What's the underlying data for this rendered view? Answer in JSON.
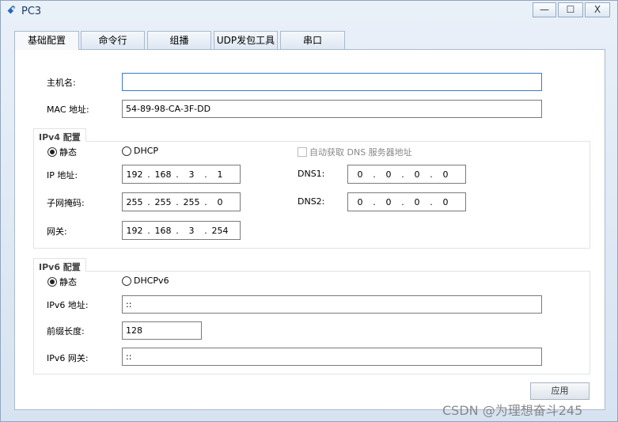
{
  "window": {
    "title": "PC3",
    "minimize": "—",
    "maximize": "☐",
    "close": "X"
  },
  "tabs": [
    {
      "label": "基础配置"
    },
    {
      "label": "命令行"
    },
    {
      "label": "组播"
    },
    {
      "label": "UDP发包工具"
    },
    {
      "label": "串口"
    }
  ],
  "basic": {
    "hostname_label": "主机名:",
    "hostname_value": "",
    "mac_label": "MAC 地址:",
    "mac_value": "54-89-98-CA-3F-DD"
  },
  "ipv4": {
    "title": "IPv4 配置",
    "static_label": "静态",
    "dhcp_label": "DHCP",
    "mode": "static",
    "auto_dns_label": "自动获取 DNS 服务器地址",
    "auto_dns_checked": false,
    "ip_label": "IP 地址:",
    "ip": [
      "192",
      "168",
      "3",
      "1"
    ],
    "mask_label": "子网掩码:",
    "mask": [
      "255",
      "255",
      "255",
      "0"
    ],
    "gateway_label": "网关:",
    "gateway": [
      "192",
      "168",
      "3",
      "254"
    ],
    "dns1_label": "DNS1:",
    "dns1": [
      "0",
      "0",
      "0",
      "0"
    ],
    "dns2_label": "DNS2:",
    "dns2": [
      "0",
      "0",
      "0",
      "0"
    ]
  },
  "ipv6": {
    "title": "IPv6 配置",
    "static_label": "静态",
    "dhcp_label": "DHCPv6",
    "mode": "static",
    "addr_label": "IPv6 地址:",
    "addr": "::",
    "prefix_label": "前缀长度:",
    "prefix": "128",
    "gateway_label": "IPv6 网关:",
    "gateway": "::"
  },
  "apply_label": "应用",
  "watermark": "CSDN @为理想奋斗245"
}
